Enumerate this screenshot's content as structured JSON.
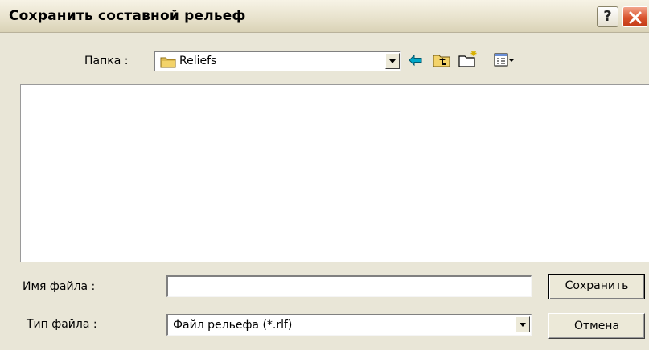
{
  "window": {
    "title": "Сохранить составной рельеф",
    "help_glyph": "?",
    "close_icon": "close-icon"
  },
  "toolbar": {
    "folder_label": "Папка :",
    "folder_value": "Reliefs",
    "icons": [
      "folder-icon",
      "back-arrow-icon",
      "up-folder-icon",
      "new-folder-icon",
      "view-menu-icon"
    ]
  },
  "form": {
    "filename_label": "Имя файла :",
    "filename_value": "",
    "filetype_label": "Тип файла :",
    "filetype_value": "Файл рельефа (*.rlf)"
  },
  "buttons": {
    "save": "Сохранить",
    "cancel": "Отмена"
  },
  "colors": {
    "dialog_bg": "#e9e6d7",
    "close_red": "#d9532c",
    "arrow_cyan": "#00a8c8",
    "folder_yellow": "#f3d36a"
  }
}
